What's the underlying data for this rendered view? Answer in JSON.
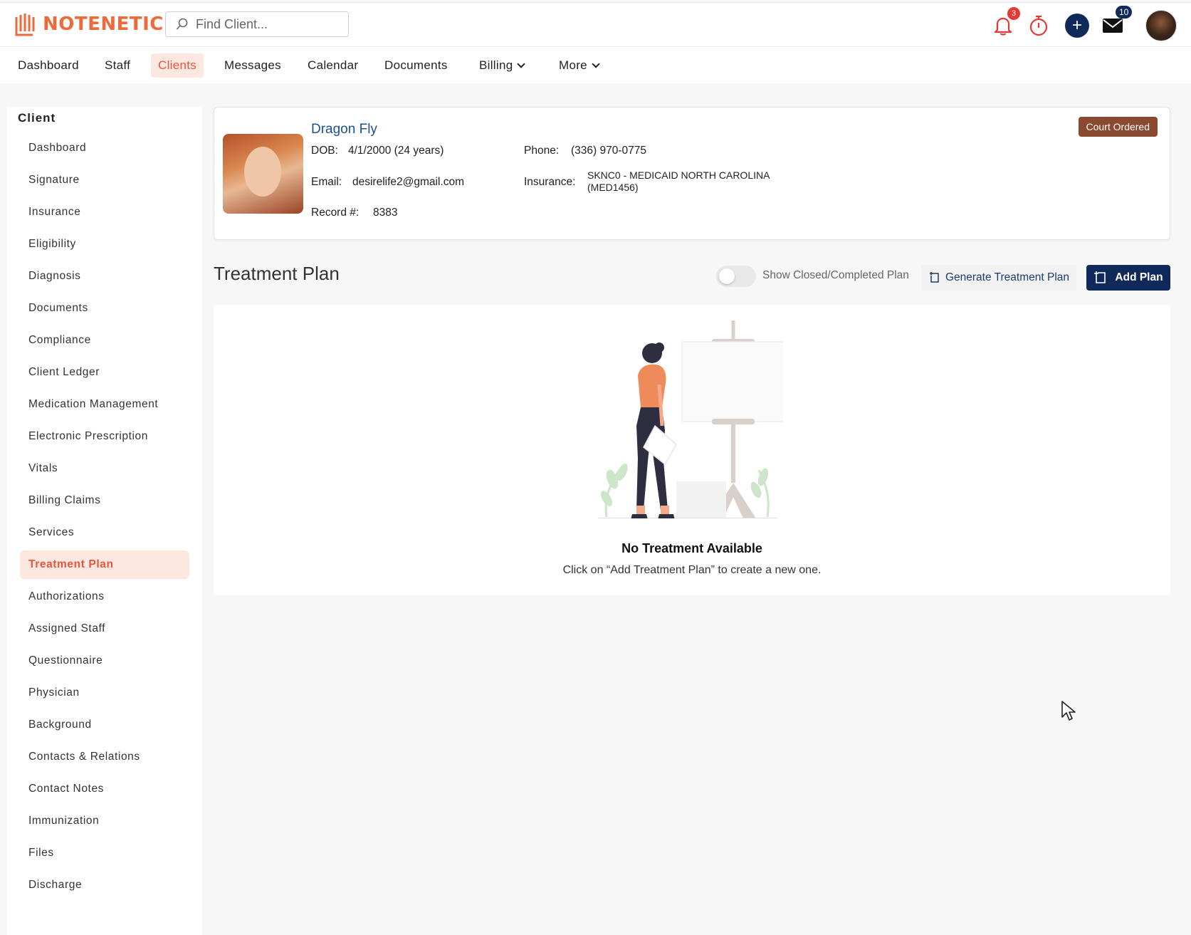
{
  "brand": {
    "name": "NOTENETIC",
    "accent": "#ef6a3a",
    "navy": "#0f2a5a"
  },
  "search": {
    "placeholder": "Find Client..."
  },
  "topbar": {
    "notifications_count": "3",
    "messages_count": "10",
    "icons": [
      "bell-icon",
      "timer-icon",
      "plus-icon",
      "mail-icon",
      "user-avatar"
    ]
  },
  "nav": {
    "items": [
      {
        "label": "Dashboard"
      },
      {
        "label": "Staff"
      },
      {
        "label": "Clients"
      },
      {
        "label": "Messages"
      },
      {
        "label": "Calendar"
      },
      {
        "label": "Documents"
      },
      {
        "label": "Billing"
      },
      {
        "label": "More"
      }
    ],
    "active": "Clients"
  },
  "sidebar": {
    "title": "Client",
    "active": "Treatment Plan",
    "items": [
      {
        "label": "Dashboard"
      },
      {
        "label": "Signature"
      },
      {
        "label": "Insurance"
      },
      {
        "label": "Eligibility"
      },
      {
        "label": "Diagnosis"
      },
      {
        "label": "Documents"
      },
      {
        "label": "Compliance"
      },
      {
        "label": "Client Ledger"
      },
      {
        "label": "Medication Management"
      },
      {
        "label": "Electronic Prescription"
      },
      {
        "label": "Vitals"
      },
      {
        "label": "Billing Claims"
      },
      {
        "label": "Services"
      },
      {
        "label": "Treatment Plan"
      },
      {
        "label": "Authorizations"
      },
      {
        "label": "Assigned Staff"
      },
      {
        "label": "Questionnaire"
      },
      {
        "label": "Physician"
      },
      {
        "label": "Background"
      },
      {
        "label": "Contacts & Relations"
      },
      {
        "label": "Contact Notes"
      },
      {
        "label": "Immunization"
      },
      {
        "label": "Files"
      },
      {
        "label": "Discharge"
      }
    ]
  },
  "client": {
    "name": "Dragon Fly",
    "dob_label": "DOB:",
    "dob": "4/1/2000 (24 years)",
    "email_label": "Email:",
    "email": "desirelife2@gmail.com",
    "record_label": "Record #:",
    "record": "8383",
    "phone_label": "Phone:",
    "phone": "(336) 970-0775",
    "insurance_label": "Insurance:",
    "insurance_line1": "SKNC0 - MEDICAID NORTH CAROLINA",
    "insurance_line2": "(MED1456)",
    "badge": "Court Ordered"
  },
  "treatment_plan": {
    "title": "Treatment Plan",
    "toggle_label": "Show Closed/Completed Plan",
    "toggle_on": false,
    "generate_label": "Generate Treatment Plan",
    "add_label": "Add Plan",
    "empty_title": "No Treatment Available",
    "empty_sub": "Click on “Add Treatment Plan” to create a new one."
  }
}
